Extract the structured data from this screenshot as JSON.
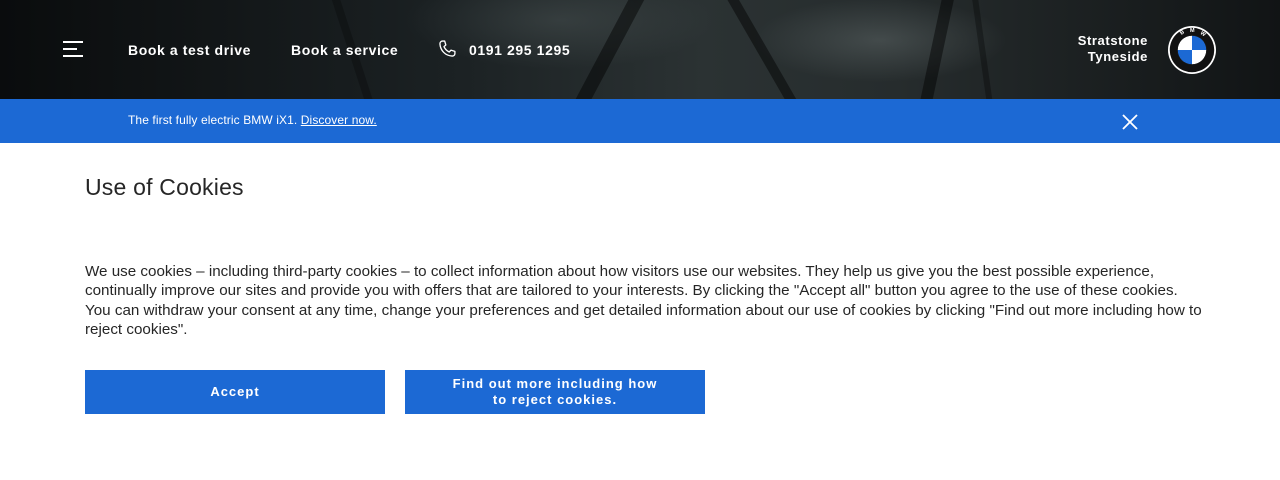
{
  "header": {
    "menu_icon": "hamburger-menu-icon",
    "nav": {
      "test_drive": "Book a test drive",
      "service": "Book a service",
      "phone_icon": "phone-icon",
      "phone": "0191 295 1295"
    },
    "dealer": {
      "line1": "Stratstone",
      "line2": "Tyneside"
    },
    "logo_icon": "bmw-roundel-icon",
    "logo_text": "BMW"
  },
  "banner": {
    "text": "The first fully electric BMW iX1.",
    "link": "Discover now.",
    "close_icon": "close-icon",
    "color": "#1c69d4"
  },
  "cookies": {
    "title": "Use of Cookies",
    "body": "We use cookies – including third-party cookies – to collect information about how visitors use our websites. They help us give you the best possible experience, continually improve our sites and provide you with offers that are tailored to your interests. By clicking the \"Accept all\" button you agree to the use of these cookies. You can withdraw your consent at any time, change your preferences and get detailed information about our use of cookies by clicking \"Find out more including how to reject cookies\".",
    "accept_label": "Accept",
    "more_label": "Find out more including how to reject cookies.",
    "button_color": "#1c69d4"
  }
}
